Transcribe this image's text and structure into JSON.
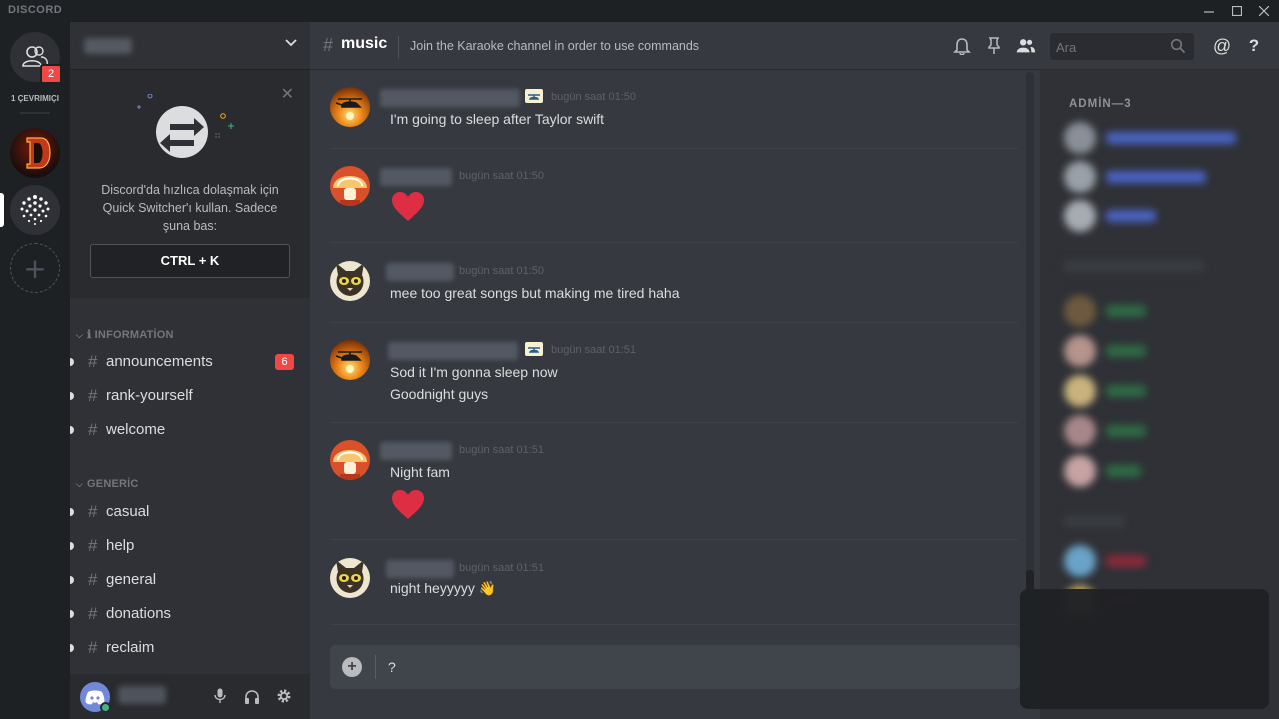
{
  "titlebar": {
    "brand": "DISCORD",
    "minimize": "—",
    "maximize": "☐",
    "close": "✕"
  },
  "servers": {
    "friends_badge": "2",
    "online_count": "1 ÇEVRIMIÇI",
    "add_label": "+"
  },
  "switcher": {
    "close": "✕",
    "text": "Discord'da hızlıca dolaşmak için Quick Switcher'ı kullan. Sadece şuna bas:",
    "shortcut": "CTRL + K"
  },
  "categories": [
    {
      "label": "ℹ INFORMATİON",
      "channels": [
        {
          "name": "announcements",
          "badge": "6"
        },
        {
          "name": "rank-yourself"
        },
        {
          "name": "welcome"
        }
      ]
    },
    {
      "label": "GENERİC",
      "channels": [
        {
          "name": "casual"
        },
        {
          "name": "help"
        },
        {
          "name": "general"
        },
        {
          "name": "donations"
        },
        {
          "name": "reclaim"
        }
      ]
    }
  ],
  "channel": {
    "hash": "#",
    "name": "music",
    "topic": "Join the Karaoke channel in order to use commands"
  },
  "search": {
    "placeholder": "Ara"
  },
  "header_icons": [
    "bell-icon",
    "pin-icon",
    "members-icon",
    "mention-icon",
    "help-icon"
  ],
  "help_label": "?",
  "mention_label": "@",
  "messages": [
    {
      "avatar": "helicopter",
      "bot": true,
      "timestamp": "bugün saat 01:50",
      "lines": [
        "I'm going to sleep after Taylor swift"
      ]
    },
    {
      "avatar": "mushroom",
      "bot": false,
      "timestamp": "bugün saat 01:50",
      "heart": true,
      "lines": []
    },
    {
      "avatar": "cat",
      "bot": false,
      "timestamp": "bugün saat 01:50",
      "lines": [
        "mee too great songs but making me tired haha"
      ]
    },
    {
      "avatar": "helicopter",
      "bot": true,
      "timestamp": "bugün saat 01:51",
      "lines": [
        "Sod it I'm gonna sleep now",
        "Goodnight guys"
      ]
    },
    {
      "avatar": "mushroom",
      "bot": false,
      "timestamp": "bugün saat 01:51",
      "heart": true,
      "lines": [
        "Night fam"
      ]
    },
    {
      "avatar": "cat",
      "bot": false,
      "timestamp": "bugün saat 01:51",
      "lines": [
        "night heyyyyy 👋"
      ]
    }
  ],
  "composer": {
    "plus": "+",
    "value": "?"
  },
  "members": {
    "admin_header": "ADMİN—3"
  },
  "colors": {
    "accent": "#7289da",
    "danger": "#f04747",
    "online": "#43b581",
    "heart": "#dd2e44"
  }
}
